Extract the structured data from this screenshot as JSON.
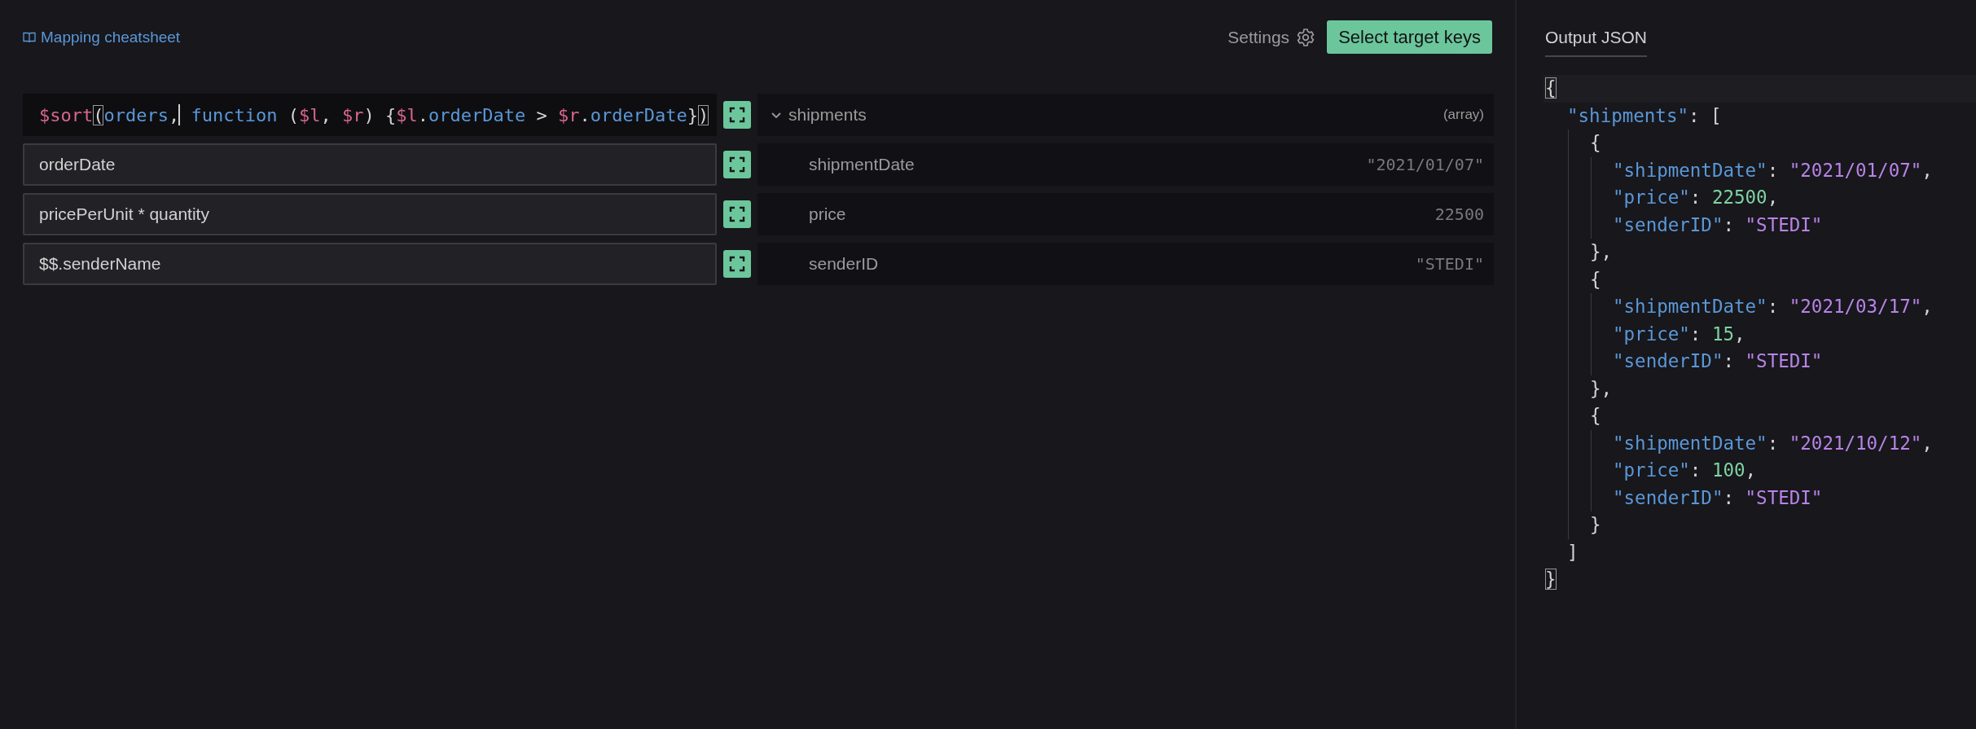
{
  "header": {
    "cheatsheet_link": "Mapping cheatsheet",
    "settings_label": "Settings",
    "select_button": "Select target keys"
  },
  "expressions": [
    {
      "kind": "code",
      "tokens": [
        {
          "kind": "var",
          "text": "$sort"
        },
        {
          "kind": "bracket",
          "text": "(",
          "matched": true
        },
        {
          "kind": "name",
          "text": "orders"
        },
        {
          "kind": "punct",
          "text": ",",
          "cursor_after": true
        },
        {
          "kind": "name",
          "text": " function "
        },
        {
          "kind": "bracket",
          "text": "(",
          "matched": false
        },
        {
          "kind": "var",
          "text": "$l"
        },
        {
          "kind": "punct",
          "text": ", "
        },
        {
          "kind": "var",
          "text": "$r"
        },
        {
          "kind": "bracket",
          "text": ")",
          "matched": false
        },
        {
          "kind": "punct",
          "text": " {"
        },
        {
          "kind": "var",
          "text": "$l"
        },
        {
          "kind": "punct",
          "text": "."
        },
        {
          "kind": "name",
          "text": "orderDate"
        },
        {
          "kind": "punct",
          "text": " > "
        },
        {
          "kind": "var",
          "text": "$r"
        },
        {
          "kind": "punct",
          "text": "."
        },
        {
          "kind": "name",
          "text": "orderDate"
        },
        {
          "kind": "bracket",
          "text": "}",
          "matched": false
        },
        {
          "kind": "bracket",
          "text": ")",
          "matched": true
        }
      ]
    },
    {
      "kind": "input",
      "value": "orderDate"
    },
    {
      "kind": "input",
      "value": "pricePerUnit * quantity"
    },
    {
      "kind": "input",
      "value": "$$.senderName"
    }
  ],
  "targets": [
    {
      "key": "shipments",
      "type": "(array)",
      "expanded": true,
      "children": [
        {
          "key": "shipmentDate",
          "value": "\"2021/01/07\""
        },
        {
          "key": "price",
          "value": "22500"
        },
        {
          "key": "senderID",
          "value": "\"STEDI\""
        }
      ]
    }
  ],
  "output": {
    "title": "Output JSON",
    "lines": [
      {
        "active": true,
        "tokens": [
          {
            "kind": "bracket",
            "text": "{",
            "matched": true
          }
        ],
        "children": [
          {
            "tokens": [
              {
                "kind": "key",
                "text": "\"shipments\""
              },
              {
                "kind": "punct",
                "text": ": ["
              }
            ],
            "children": [
              {
                "tokens": [
                  {
                    "kind": "punct",
                    "text": "{"
                  }
                ],
                "children": [
                  {
                    "tokens": [
                      {
                        "kind": "key",
                        "text": "\"shipmentDate\""
                      },
                      {
                        "kind": "punct",
                        "text": ": "
                      },
                      {
                        "kind": "string",
                        "text": "\"2021/01/07\""
                      },
                      {
                        "kind": "punct",
                        "text": ","
                      }
                    ]
                  },
                  {
                    "tokens": [
                      {
                        "kind": "key",
                        "text": "\"price\""
                      },
                      {
                        "kind": "punct",
                        "text": ": "
                      },
                      {
                        "kind": "number",
                        "text": "22500"
                      },
                      {
                        "kind": "punct",
                        "text": ","
                      }
                    ]
                  },
                  {
                    "tokens": [
                      {
                        "kind": "key",
                        "text": "\"senderID\""
                      },
                      {
                        "kind": "punct",
                        "text": ": "
                      },
                      {
                        "kind": "string",
                        "text": "\"STEDI\""
                      }
                    ]
                  }
                ]
              },
              {
                "tokens": [
                  {
                    "kind": "punct",
                    "text": "},"
                  }
                ]
              },
              {
                "tokens": [
                  {
                    "kind": "punct",
                    "text": "{"
                  }
                ],
                "children": [
                  {
                    "tokens": [
                      {
                        "kind": "key",
                        "text": "\"shipmentDate\""
                      },
                      {
                        "kind": "punct",
                        "text": ": "
                      },
                      {
                        "kind": "string",
                        "text": "\"2021/03/17\""
                      },
                      {
                        "kind": "punct",
                        "text": ","
                      }
                    ]
                  },
                  {
                    "tokens": [
                      {
                        "kind": "key",
                        "text": "\"price\""
                      },
                      {
                        "kind": "punct",
                        "text": ": "
                      },
                      {
                        "kind": "number",
                        "text": "15"
                      },
                      {
                        "kind": "punct",
                        "text": ","
                      }
                    ]
                  },
                  {
                    "tokens": [
                      {
                        "kind": "key",
                        "text": "\"senderID\""
                      },
                      {
                        "kind": "punct",
                        "text": ": "
                      },
                      {
                        "kind": "string",
                        "text": "\"STEDI\""
                      }
                    ]
                  }
                ]
              },
              {
                "tokens": [
                  {
                    "kind": "punct",
                    "text": "},"
                  }
                ]
              },
              {
                "tokens": [
                  {
                    "kind": "punct",
                    "text": "{"
                  }
                ],
                "children": [
                  {
                    "tokens": [
                      {
                        "kind": "key",
                        "text": "\"shipmentDate\""
                      },
                      {
                        "kind": "punct",
                        "text": ": "
                      },
                      {
                        "kind": "string",
                        "text": "\"2021/10/12\""
                      },
                      {
                        "kind": "punct",
                        "text": ","
                      }
                    ]
                  },
                  {
                    "tokens": [
                      {
                        "kind": "key",
                        "text": "\"price\""
                      },
                      {
                        "kind": "punct",
                        "text": ": "
                      },
                      {
                        "kind": "number",
                        "text": "100"
                      },
                      {
                        "kind": "punct",
                        "text": ","
                      }
                    ]
                  },
                  {
                    "tokens": [
                      {
                        "kind": "key",
                        "text": "\"senderID\""
                      },
                      {
                        "kind": "punct",
                        "text": ": "
                      },
                      {
                        "kind": "string",
                        "text": "\"STEDI\""
                      }
                    ]
                  }
                ]
              },
              {
                "tokens": [
                  {
                    "kind": "punct",
                    "text": "}"
                  }
                ]
              }
            ]
          },
          {
            "tokens": [
              {
                "kind": "punct",
                "text": "]"
              }
            ]
          }
        ]
      },
      {
        "tokens": [
          {
            "kind": "bracket",
            "text": "}",
            "matched": true
          }
        ]
      }
    ]
  }
}
